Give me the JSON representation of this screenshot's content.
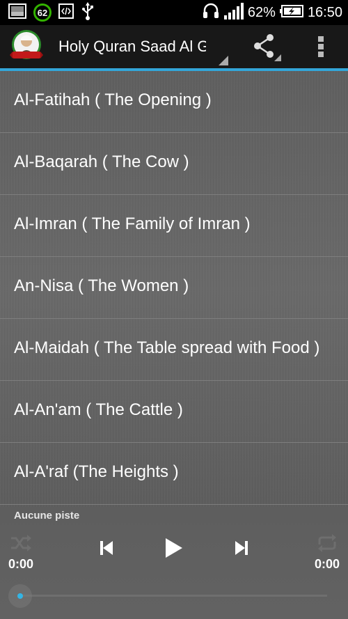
{
  "status_bar": {
    "icons_left": [
      "gallery-icon",
      "battery-saver-badge-icon",
      "developer-icon",
      "usb-icon"
    ],
    "badge_value": "62",
    "icons_right": [
      "headset-icon",
      "signal-icon",
      "battery-icon"
    ],
    "battery_percent": "62%",
    "time": "16:50"
  },
  "action_bar": {
    "title": "Holy Quran Saad Al Ghamdi",
    "logo_icon": "reciter-avatar-icon",
    "share_icon": "share-icon",
    "overflow_icon": "overflow-menu-icon",
    "accent_color": "#33a6d9"
  },
  "surahs": [
    {
      "label": "Al-Fatihah ( The Opening )"
    },
    {
      "label": "Al-Baqarah ( The Cow )"
    },
    {
      "label": "Al-Imran ( The Family of Imran )"
    },
    {
      "label": "An-Nisa ( The Women )"
    },
    {
      "label": "Al-Maidah ( The Table spread with Food )"
    },
    {
      "label": "Al-An'am ( The Cattle )"
    },
    {
      "label": "Al-A'raf (The Heights )"
    }
  ],
  "player": {
    "track": "Aucune piste",
    "time_elapsed": "0:00",
    "time_total": "0:00",
    "progress": 0,
    "icons": [
      "shuffle-icon",
      "previous-icon",
      "play-icon",
      "next-icon",
      "repeat-icon"
    ],
    "progress_color": "#33b5e5"
  }
}
